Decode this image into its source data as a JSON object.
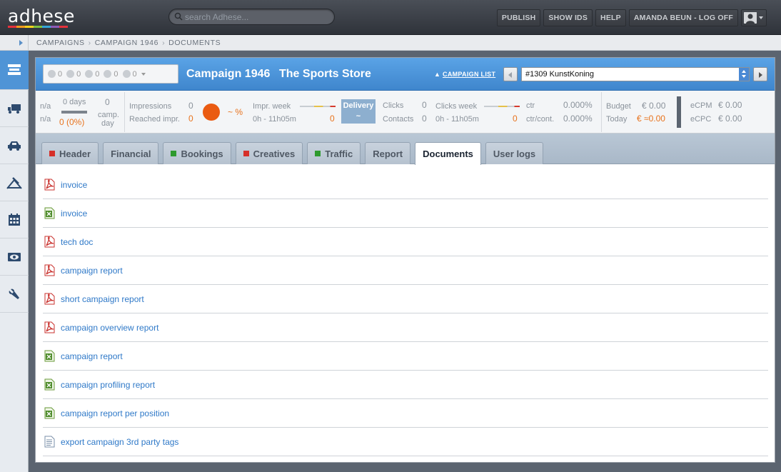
{
  "app": {
    "logo": "adhese",
    "logo_colors": [
      "#e5313b",
      "#f29a1d",
      "#f7d21c",
      "#7fbf3f",
      "#35a6d9",
      "#8f5bb8",
      "#e5313b"
    ]
  },
  "search": {
    "placeholder": "search Adhese..."
  },
  "topnav": {
    "publish": "PUBLISH",
    "show_ids": "SHOW IDS",
    "help": "HELP",
    "user": "AMANDA BEUN - LOG OFF"
  },
  "breadcrumb": [
    "CAMPAIGNS",
    "CAMPAIGN 1946",
    "DOCUMENTS"
  ],
  "sidebar": {
    "items": [
      {
        "icon": "layers-icon"
      },
      {
        "icon": "truck-icon"
      },
      {
        "icon": "car-icon"
      },
      {
        "icon": "crane-icon"
      },
      {
        "icon": "calendar-icon"
      },
      {
        "icon": "eye-icon"
      },
      {
        "icon": "wrench-icon"
      }
    ]
  },
  "status": {
    "counts": [
      "0",
      "0",
      "0",
      "0",
      "0"
    ]
  },
  "campaign": {
    "title": "Campaign 1946",
    "name": "The Sports Store",
    "list_link": "CAMPAIGN LIST",
    "selector": "#1309 KunstKoning"
  },
  "stats": {
    "na1": "n/a",
    "na2": "n/a",
    "days": "0 days",
    "days_pct": "0 (0%)",
    "camp_day_val": "0",
    "camp_day_label1": "camp.",
    "camp_day_label2": "day",
    "impressions_label": "Impressions",
    "impressions_val": "0",
    "reached_label": "Reached impr.",
    "reached_val": "0",
    "pct": "~ %",
    "impr_week_label": "Impr. week",
    "impr_week_range": "0h - 11h05m",
    "impr_week_val": "0",
    "delivery_label": "Delivery",
    "delivery_val": "~",
    "clicks_label": "Clicks",
    "clicks_val": "0",
    "contacts_label": "Contacts",
    "contacts_val": "0",
    "clicks_week_label": "Clicks week",
    "clicks_week_range": "0h - 11h05m",
    "clicks_week_val": "0",
    "ctr_label": "ctr",
    "ctr_val": "0.000%",
    "ctrcont_label": "ctr/cont.",
    "ctrcont_val": "0.000%",
    "budget_label": "Budget",
    "budget_val": "€ 0.00",
    "today_label": "Today",
    "today_val": "€ ≈0.00",
    "ecpm_label": "eCPM",
    "ecpm_val": "€ 0.00",
    "ecpc_label": "eCPC",
    "ecpc_val": "€ 0.00"
  },
  "tabs": [
    {
      "label": "Header",
      "marker": "#d6302a"
    },
    {
      "label": "Financial",
      "marker": ""
    },
    {
      "label": "Bookings",
      "marker": "#2e9a2e"
    },
    {
      "label": "Creatives",
      "marker": "#d6302a"
    },
    {
      "label": "Traffic",
      "marker": "#2e9a2e"
    },
    {
      "label": "Report",
      "marker": ""
    },
    {
      "label": "Documents",
      "marker": "",
      "active": true
    },
    {
      "label": "User logs",
      "marker": ""
    }
  ],
  "documents": [
    {
      "name": "invoice",
      "type": "pdf"
    },
    {
      "name": "invoice",
      "type": "xls"
    },
    {
      "name": "tech doc",
      "type": "pdf"
    },
    {
      "name": "campaign report",
      "type": "pdf"
    },
    {
      "name": "short campaign report",
      "type": "pdf"
    },
    {
      "name": "campaign overview report",
      "type": "pdf"
    },
    {
      "name": "campaign report",
      "type": "xls"
    },
    {
      "name": "campaign profiling report",
      "type": "xls"
    },
    {
      "name": "campaign report per position",
      "type": "xls"
    },
    {
      "name": "export campaign 3rd party tags",
      "type": "txt"
    }
  ],
  "colors": {
    "accent": "#4a8fd6",
    "link": "#2f79c8",
    "orange": "#e8731d",
    "delivery": "#8dafcf"
  }
}
